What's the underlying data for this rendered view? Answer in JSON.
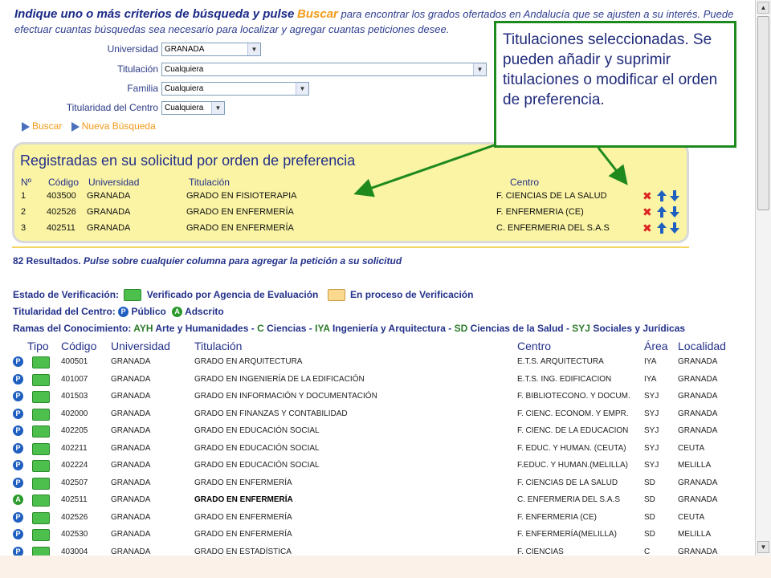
{
  "intro": {
    "lead": "Indique uno o más criterios de búsqueda y pulse",
    "keyword": "Buscar",
    "rest": "para encontrar los grados ofertados en Andalucía que se ajusten a su interés. Puede efectuar cuantas búsquedas sea necesario para localizar y agregar cuantas peticiones desee."
  },
  "filters": {
    "universidad_label": "Universidad",
    "universidad_value": "GRANADA",
    "titulacion_label": "Titulación",
    "titulacion_value": "Cualquiera",
    "familia_label": "Familia",
    "familia_value": "Cualquiera",
    "titularidad_label": "Titularidad del Centro",
    "titularidad_value": "Cualquiera"
  },
  "actions": {
    "buscar": "Buscar",
    "nueva": "Nueva Búsqueda"
  },
  "registered": {
    "title": "Registradas en su solicitud por orden de preferencia",
    "headers": {
      "no": "Nº",
      "codigo": "Código",
      "universidad": "Universidad",
      "titulacion": "Titulación",
      "centro": "Centro"
    },
    "rows": [
      {
        "no": "1",
        "codigo": "403500",
        "universidad": "GRANADA",
        "titulacion": "GRADO EN FISIOTERAPIA",
        "centro": "F. CIENCIAS DE LA SALUD"
      },
      {
        "no": "2",
        "codigo": "402526",
        "universidad": "GRANADA",
        "titulacion": "GRADO EN ENFERMERÍA",
        "centro": "F. ENFERMERIA (CE)"
      },
      {
        "no": "3",
        "codigo": "402511",
        "universidad": "GRANADA",
        "titulacion": "GRADO EN ENFERMERÍA",
        "centro": "C. ENFERMERIA DEL S.A.S"
      }
    ]
  },
  "results": {
    "count_text": "82 Resultados.",
    "hint": "Pulse sobre cualquier columna para agregar la petición a su solicitud"
  },
  "legend": {
    "estado_label": "Estado de Verificación:",
    "verificado": "Verificado por Agencia de Evaluación",
    "en_proceso": "En proceso de Verificación",
    "titularidad_label": "Titularidad del Centro:",
    "publico": "Público",
    "adscrito": "Adscrito",
    "ramas_label": "Ramas del Conocimiento:",
    "ramas": [
      {
        "code": "AYH",
        "name": "Arte y Humanidades"
      },
      {
        "code": "C",
        "name": "Ciencias"
      },
      {
        "code": "IYA",
        "name": "Ingeniería y Arquitectura"
      },
      {
        "code": "SD",
        "name": "Ciencias de la Salud"
      },
      {
        "code": "SYJ",
        "name": "Sociales y Jurídicas"
      }
    ]
  },
  "table": {
    "headers": {
      "tipo": "Tipo",
      "codigo": "Código",
      "universidad": "Universidad",
      "titulacion": "Titulación",
      "centro": "Centro",
      "area": "Área",
      "localidad": "Localidad"
    },
    "rows": [
      {
        "badge": "P",
        "codigo": "400501",
        "universidad": "GRANADA",
        "titulacion": "GRADO EN ARQUITECTURA",
        "centro": "E.T.S. ARQUITECTURA",
        "area": "IYA",
        "localidad": "GRANADA"
      },
      {
        "badge": "P",
        "codigo": "401007",
        "universidad": "GRANADA",
        "titulacion": "GRADO EN INGENIERÍA DE LA EDIFICACIÓN",
        "centro": "E.T.S. ING. EDIFICACION",
        "area": "IYA",
        "localidad": "GRANADA"
      },
      {
        "badge": "P",
        "codigo": "401503",
        "universidad": "GRANADA",
        "titulacion": "GRADO EN INFORMACIÓN Y DOCUMENTACIÓN",
        "centro": "F. BIBLIOTECONO. Y DOCUM.",
        "area": "SYJ",
        "localidad": "GRANADA"
      },
      {
        "badge": "P",
        "codigo": "402000",
        "universidad": "GRANADA",
        "titulacion": "GRADO EN FINANZAS Y CONTABILIDAD",
        "centro": "F. CIENC. ECONOM. Y EMPR.",
        "area": "SYJ",
        "localidad": "GRANADA"
      },
      {
        "badge": "P",
        "codigo": "402205",
        "universidad": "GRANADA",
        "titulacion": "GRADO EN EDUCACIÓN SOCIAL",
        "centro": "F. CIENC. DE LA EDUCACION",
        "area": "SYJ",
        "localidad": "GRANADA"
      },
      {
        "badge": "P",
        "codigo": "402211",
        "universidad": "GRANADA",
        "titulacion": "GRADO EN EDUCACIÓN SOCIAL",
        "centro": "F. EDUC. Y HUMAN. (CEUTA)",
        "area": "SYJ",
        "localidad": "CEUTA"
      },
      {
        "badge": "P",
        "codigo": "402224",
        "universidad": "GRANADA",
        "titulacion": "GRADO EN EDUCACIÓN SOCIAL",
        "centro": "F.EDUC. Y HUMAN.(MELILLA)",
        "area": "SYJ",
        "localidad": "MELILLA"
      },
      {
        "badge": "P",
        "codigo": "402507",
        "universidad": "GRANADA",
        "titulacion": "GRADO EN ENFERMERÍA",
        "centro": "F. CIENCIAS DE LA SALUD",
        "area": "SD",
        "localidad": "GRANADA"
      },
      {
        "badge": "A",
        "codigo": "402511",
        "universidad": "GRANADA",
        "titulacion": "GRADO EN ENFERMERÍA",
        "centro": "C. ENFERMERIA DEL S.A.S",
        "area": "SD",
        "localidad": "GRANADA"
      },
      {
        "badge": "P",
        "codigo": "402526",
        "universidad": "GRANADA",
        "titulacion": "GRADO EN ENFERMERÍA",
        "centro": "F. ENFERMERIA (CE)",
        "area": "SD",
        "localidad": "CEUTA"
      },
      {
        "badge": "P",
        "codigo": "402530",
        "universidad": "GRANADA",
        "titulacion": "GRADO EN ENFERMERÍA",
        "centro": "F. ENFERMERÍA(MELILLA)",
        "area": "SD",
        "localidad": "MELILLA"
      },
      {
        "badge": "P",
        "codigo": "403004",
        "universidad": "GRANADA",
        "titulacion": "GRADO EN ESTADÍSTICA",
        "centro": "F. CIENCIAS",
        "area": "C",
        "localidad": "GRANADA"
      }
    ]
  },
  "callout": {
    "text": "Titulaciones seleccionadas. Se pueden añadir y suprimir titulaciones o modificar el orden de preferencia."
  },
  "colors": {
    "accent_orange": "#f39a16",
    "text_blue": "#23318a",
    "verified_green": "#4cbf4c",
    "in_process_orange": "#fcd98e",
    "callout_border": "#1e8a1e"
  }
}
